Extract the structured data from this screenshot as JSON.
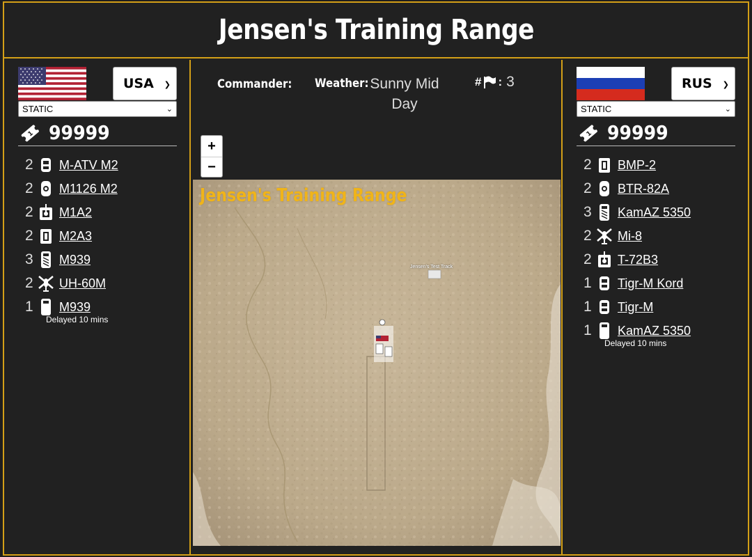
{
  "title": "Jensen's Training Range",
  "colors": {
    "accent": "#d4a017",
    "map_title": "#f0b419",
    "background": "#212121"
  },
  "left": {
    "country": "USA",
    "mode": "STATIC",
    "tickets": "99999",
    "units": [
      {
        "count": "2",
        "name": "M-ATV M2",
        "icon": "mrap-icon"
      },
      {
        "count": "2",
        "name": "M1126 M2",
        "icon": "apc-icon"
      },
      {
        "count": "2",
        "name": "M1A2",
        "icon": "tank-icon"
      },
      {
        "count": "2",
        "name": "M2A3",
        "icon": "ifv-icon"
      },
      {
        "count": "3",
        "name": "M939",
        "icon": "truck-icon"
      },
      {
        "count": "2",
        "name": "UH-60M",
        "icon": "helicopter-icon"
      },
      {
        "count": "1",
        "name": "M939",
        "icon": "truck-icon"
      }
    ],
    "delay": "Delayed 10 mins"
  },
  "right": {
    "country": "RUS",
    "mode": "STATIC",
    "tickets": "99999",
    "units": [
      {
        "count": "2",
        "name": "BMP-2",
        "icon": "ifv-icon"
      },
      {
        "count": "2",
        "name": "BTR-82A",
        "icon": "apc-icon"
      },
      {
        "count": "3",
        "name": "KamAZ 5350",
        "icon": "truck-icon"
      },
      {
        "count": "2",
        "name": "Mi-8",
        "icon": "helicopter-icon"
      },
      {
        "count": "2",
        "name": "T-72B3",
        "icon": "tank-icon"
      },
      {
        "count": "1",
        "name": "Tigr-M Kord",
        "icon": "mrap-icon"
      },
      {
        "count": "1",
        "name": "Tigr-M",
        "icon": "mrap-icon"
      },
      {
        "count": "1",
        "name": "KamAZ 5350",
        "icon": "truck-icon"
      }
    ],
    "delay": "Delayed 10 mins"
  },
  "info": {
    "commander_label": "Commander:",
    "weather_label": "Weather:",
    "weather_value": "Sunny Mid Day",
    "flags_prefix": "#",
    "flags_sep": ":",
    "flags_count": "3"
  },
  "zoom": {
    "in": "+",
    "out": "−"
  },
  "map": {
    "title": "Jensen's Training Range",
    "marker_label": "Jensen's Test Track"
  }
}
